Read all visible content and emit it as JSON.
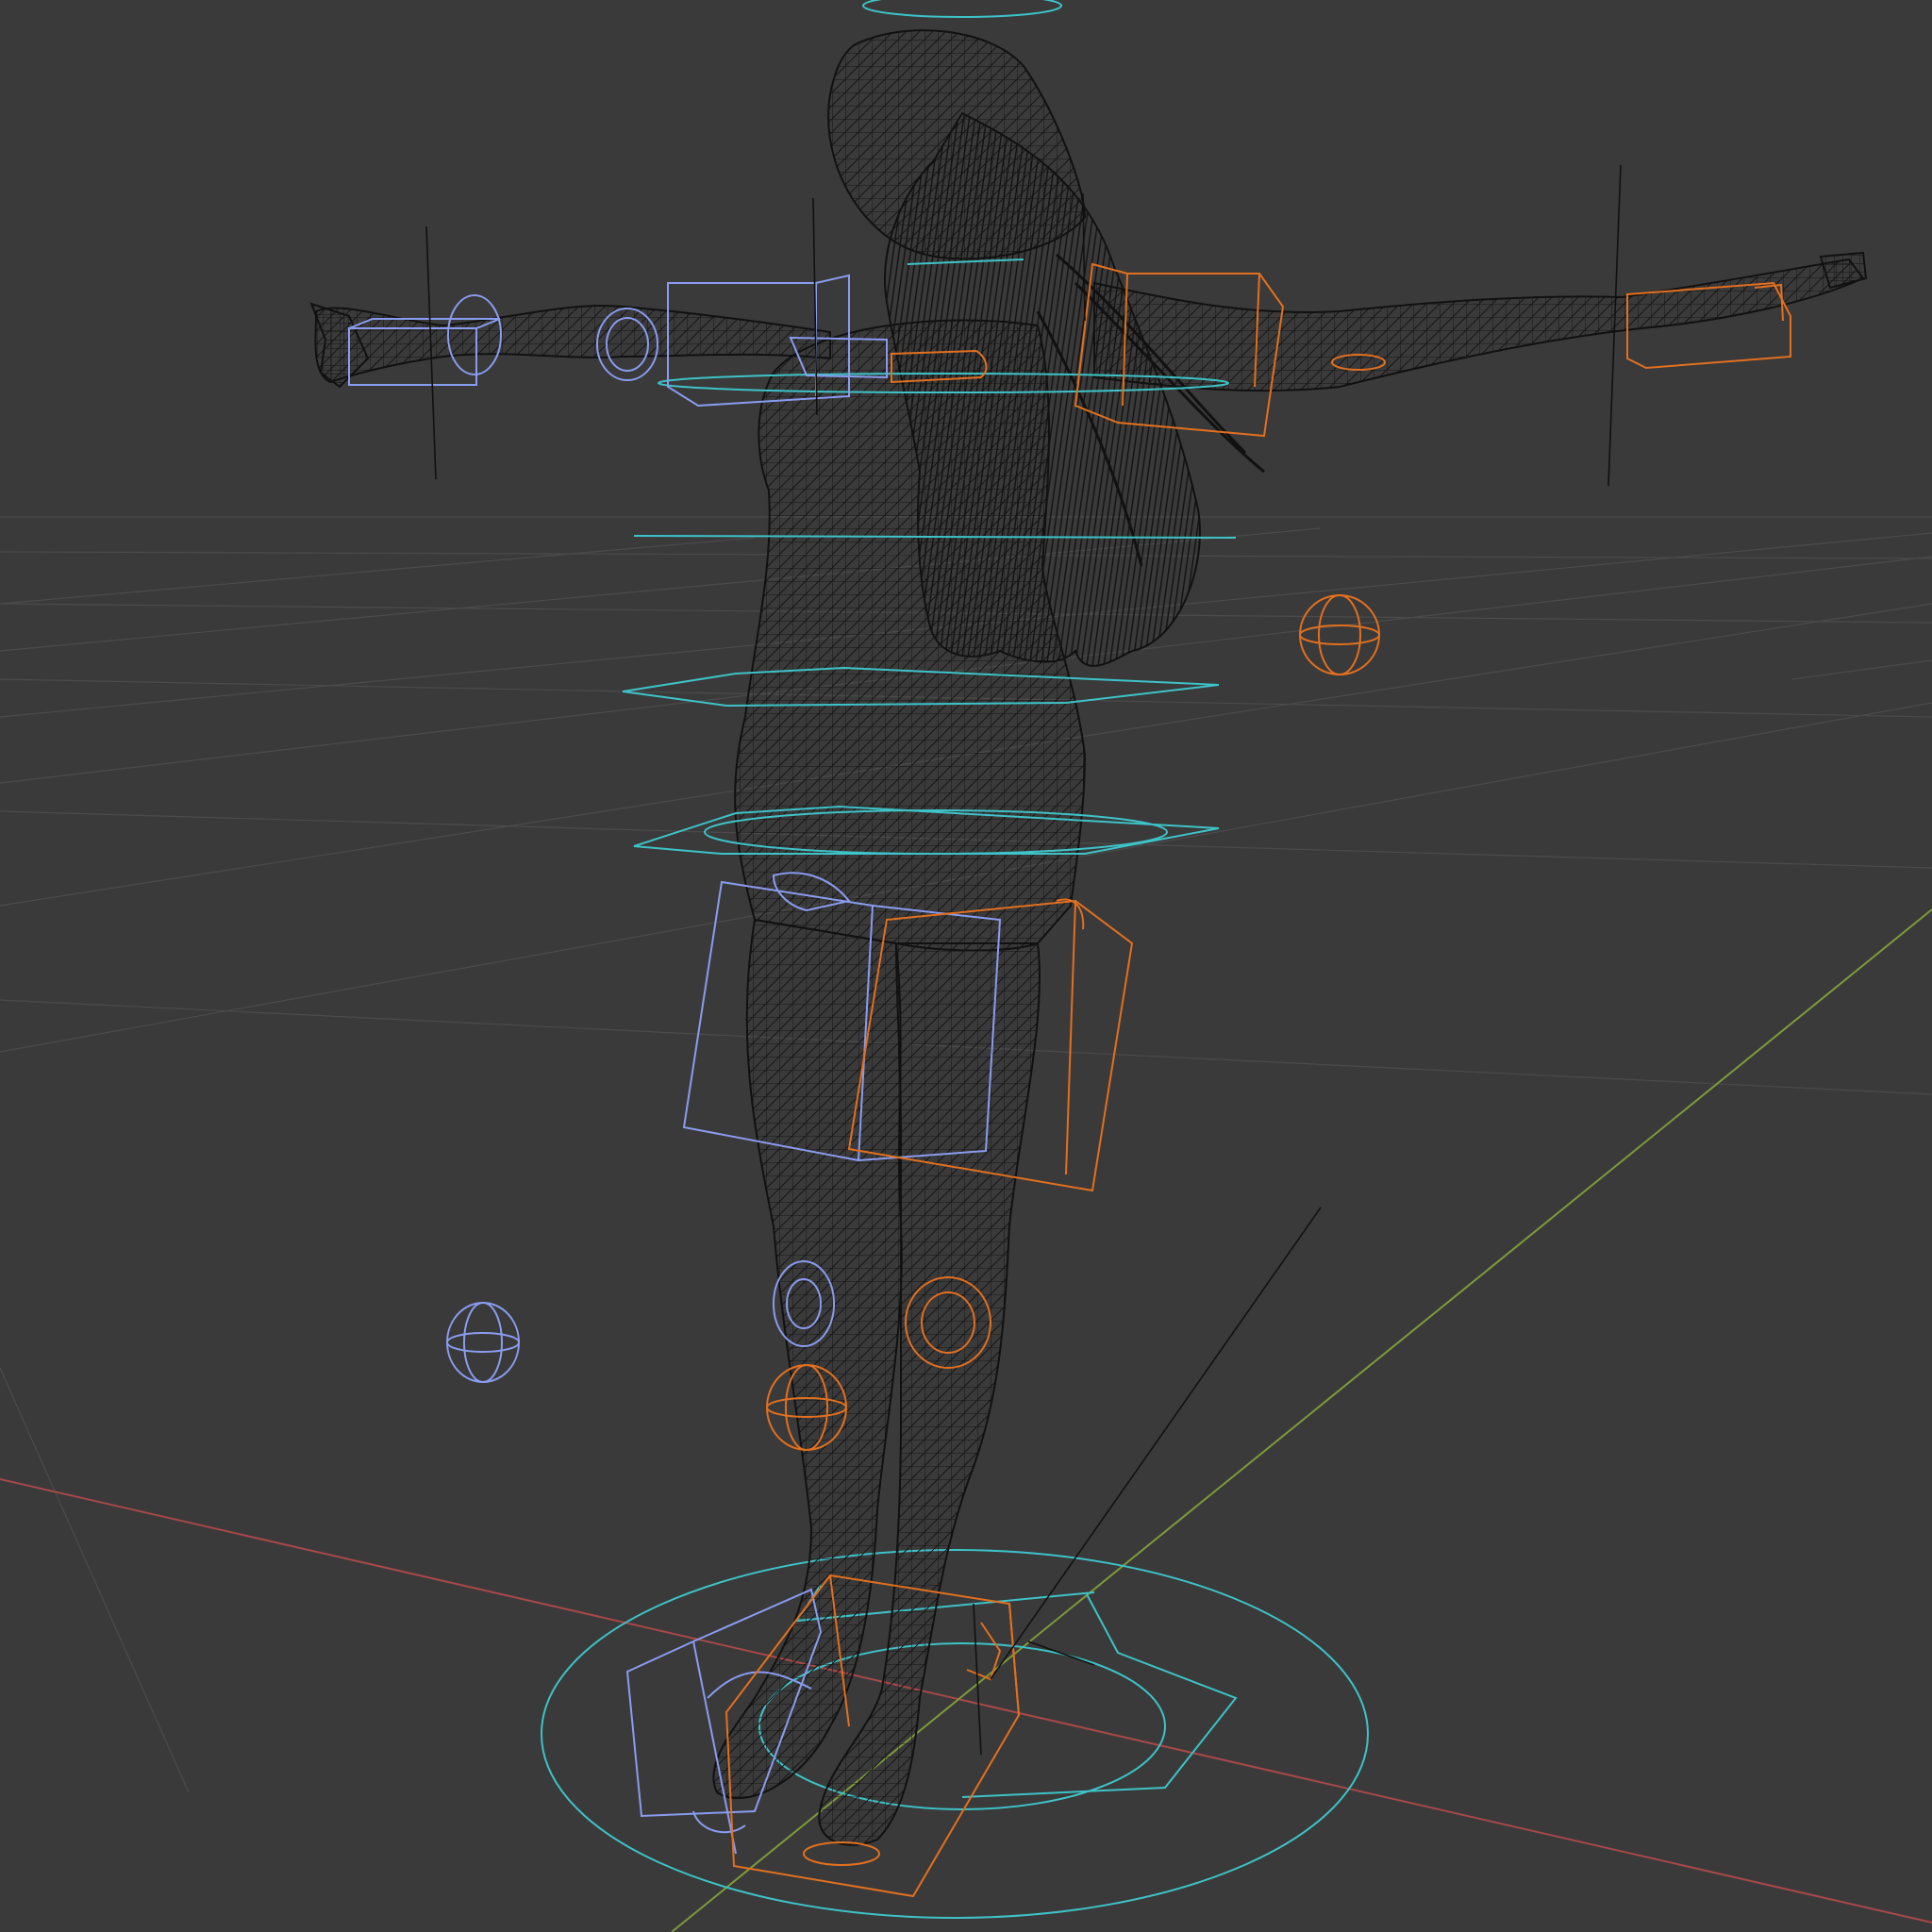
{
  "viewport": {
    "background": "#3a3a3a",
    "grid_color": "#4a4a4a",
    "x_axis_color": "#a84848",
    "y_axis_color": "#7f9a3a",
    "mesh_color": "#111111",
    "cyan_control_color": "#3ec3c8",
    "blue_control_color": "#8a9cf0",
    "orange_control_color": "#e2701f"
  },
  "scene": {
    "object": "character-wireframe",
    "shading": "wireframe",
    "rig_controls": [
      "root-circle",
      "torso-rings",
      "hand-ik-boxes",
      "thigh-boxes",
      "knee-poles",
      "foot-boxes",
      "shoulder-boxes",
      "pole-targets"
    ]
  }
}
